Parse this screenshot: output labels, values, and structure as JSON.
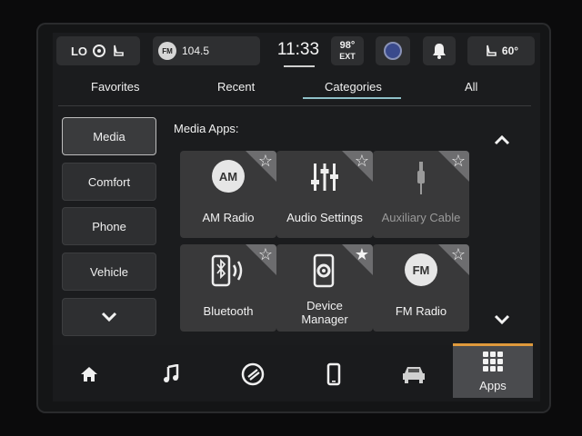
{
  "status": {
    "climate_left": "LO",
    "radio_badge": "FM",
    "radio_station": "104.5",
    "time": "11:33",
    "outside_temp": "98°",
    "outside_label": "EXT",
    "climate_right": "60°"
  },
  "tabs": [
    {
      "label": "Favorites"
    },
    {
      "label": "Recent"
    },
    {
      "label": "Categories",
      "selected": true
    },
    {
      "label": "All"
    }
  ],
  "sidebar": {
    "items": [
      {
        "label": "Media",
        "active": true
      },
      {
        "label": "Comfort"
      },
      {
        "label": "Phone"
      },
      {
        "label": "Vehicle"
      }
    ],
    "more_icon": "chevron-down-icon"
  },
  "section": {
    "title": "Media Apps:"
  },
  "apps": [
    {
      "label": "AM Radio",
      "badge": "AM",
      "icon": "am-radio-icon",
      "favorite": false
    },
    {
      "label": "Audio Settings",
      "icon": "equalizer-icon",
      "favorite": false
    },
    {
      "label": "Auxiliary Cable",
      "icon": "aux-cable-icon",
      "favorite": false,
      "disabled": true
    },
    {
      "label": "Bluetooth",
      "icon": "bluetooth-phone-icon",
      "favorite": false
    },
    {
      "label": "Device Manager",
      "label_line1": "Device",
      "label_line2": "Manager",
      "icon": "device-manager-icon",
      "favorite": true
    },
    {
      "label": "FM Radio",
      "badge": "FM",
      "icon": "fm-radio-icon",
      "favorite": false
    }
  ],
  "bottom_nav": {
    "items": [
      "home-icon",
      "music-note-icon",
      "phone-link-icon",
      "phone-icon",
      "car-icon",
      "apps-grid-icon"
    ],
    "apps_label": "Apps",
    "active_color": "#e09a3c"
  },
  "colors": {
    "tab_underline": "#8fc0c8",
    "apps_active": "#e09a3c"
  }
}
